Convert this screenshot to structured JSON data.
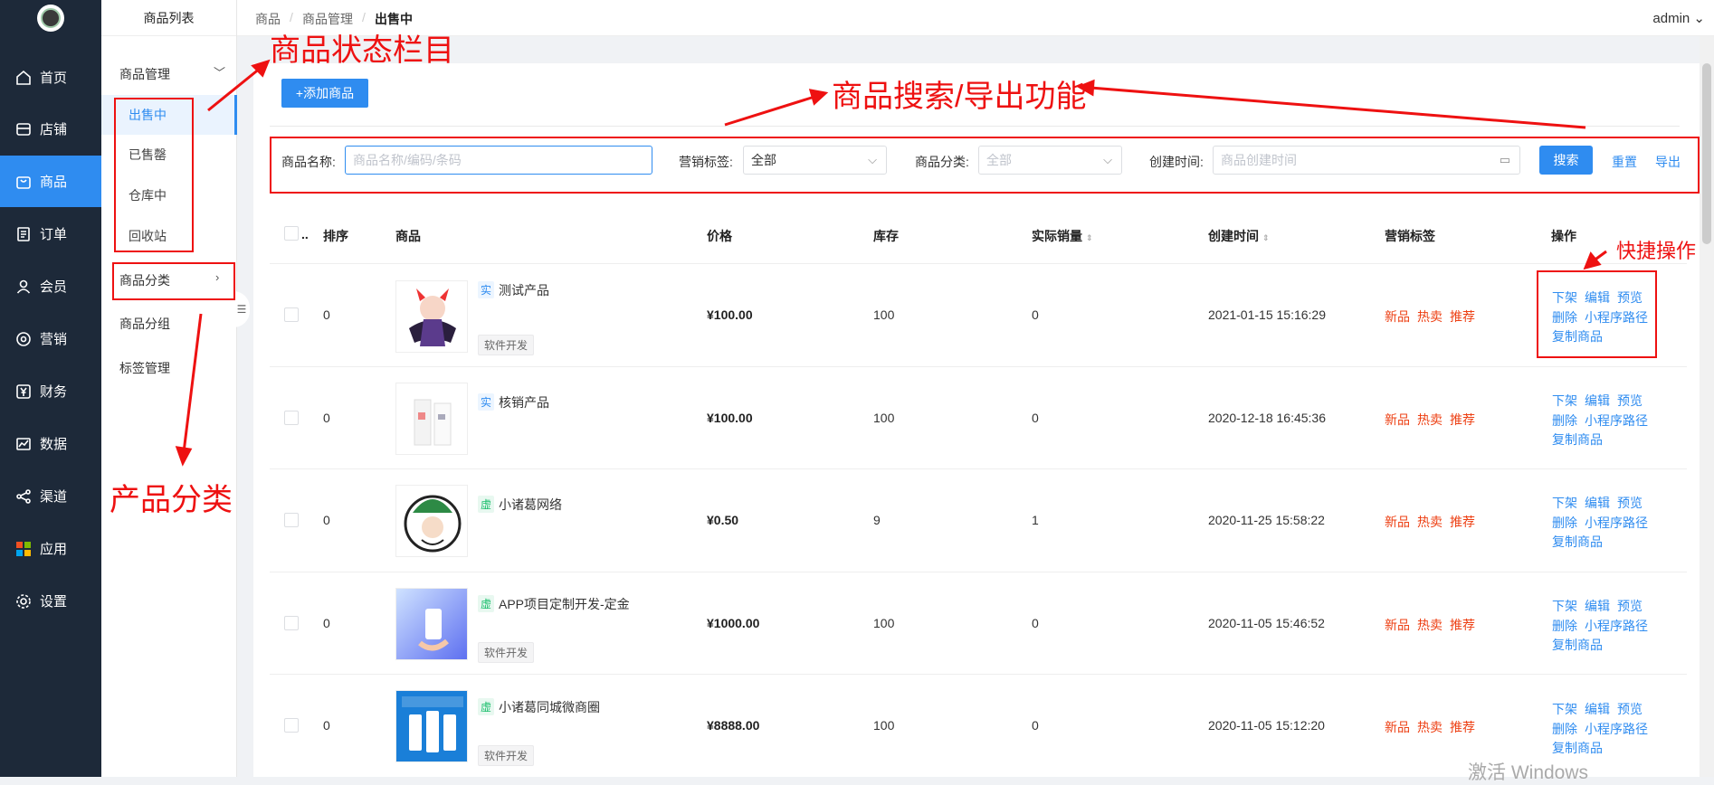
{
  "sidebar": {
    "items": [
      {
        "label": "首页",
        "icon": "home-icon"
      },
      {
        "label": "店铺",
        "icon": "store-icon"
      },
      {
        "label": "商品",
        "icon": "bag-icon"
      },
      {
        "label": "订单",
        "icon": "order-icon"
      },
      {
        "label": "会员",
        "icon": "user-icon"
      },
      {
        "label": "营销",
        "icon": "marketing-icon"
      },
      {
        "label": "财务",
        "icon": "yen-icon"
      },
      {
        "label": "数据",
        "icon": "chart-icon"
      },
      {
        "label": "渠道",
        "icon": "share-icon"
      },
      {
        "label": "应用",
        "icon": "apps-icon"
      },
      {
        "label": "设置",
        "icon": "gear-icon"
      }
    ],
    "active_index": 2
  },
  "subnav": {
    "title": "商品列表",
    "group": "商品管理",
    "group_items": [
      "出售中",
      "已售罄",
      "仓库中",
      "回收站"
    ],
    "links": [
      "商品分类",
      "商品分组",
      "标签管理"
    ]
  },
  "breadcrumb": [
    "商品",
    "商品管理",
    "出售中"
  ],
  "user": "admin",
  "add_button": "+添加商品",
  "filters": {
    "name_label": "商品名称:",
    "name_placeholder": "商品名称/编码/条码",
    "tag_label": "营销标签:",
    "tag_value": "全部",
    "category_label": "商品分类:",
    "category_value": "全部",
    "time_label": "创建时间:",
    "time_placeholder": "商品创建时间",
    "search": "搜索",
    "reset": "重置",
    "export": "导出"
  },
  "table": {
    "columns": [
      "排序",
      "商品",
      "价格",
      "库存",
      "实际销量",
      "创建时间",
      "营销标签",
      "操作"
    ],
    "rows": [
      {
        "sort": "0",
        "type": "实",
        "name": "测试产品",
        "tag": "软件开发",
        "price": "¥100.00",
        "stock": "100",
        "sales": "0",
        "created": "2021-01-15 15:16:29"
      },
      {
        "sort": "0",
        "type": "实",
        "name": "核销产品",
        "tag": "",
        "price": "¥100.00",
        "stock": "100",
        "sales": "0",
        "created": "2020-12-18 16:45:36"
      },
      {
        "sort": "0",
        "type": "虚",
        "name": "小诸葛网络",
        "tag": "",
        "price": "¥0.50",
        "stock": "9",
        "sales": "1",
        "created": "2020-11-25 15:58:22"
      },
      {
        "sort": "0",
        "type": "虚",
        "name": "APP项目定制开发-定金",
        "tag": "软件开发",
        "price": "¥1000.00",
        "stock": "100",
        "sales": "0",
        "created": "2020-11-05 15:46:52"
      },
      {
        "sort": "0",
        "type": "虚",
        "name": "小诸葛同城微商圈",
        "tag": "软件开发",
        "price": "¥8888.00",
        "stock": "100",
        "sales": "0",
        "created": "2020-11-05 15:12:20"
      }
    ],
    "marketing_tags": [
      "新品",
      "热卖",
      "推荐"
    ],
    "actions": [
      "下架",
      "编辑",
      "预览",
      "删除",
      "小程序路径",
      "复制商品"
    ]
  },
  "annotations": {
    "status_bar": "商品状态栏目",
    "search_export": "商品搜索/导出功能",
    "product_category": "产品分类",
    "quick_ops": "快捷操作"
  },
  "watermark": "激活 Windows"
}
